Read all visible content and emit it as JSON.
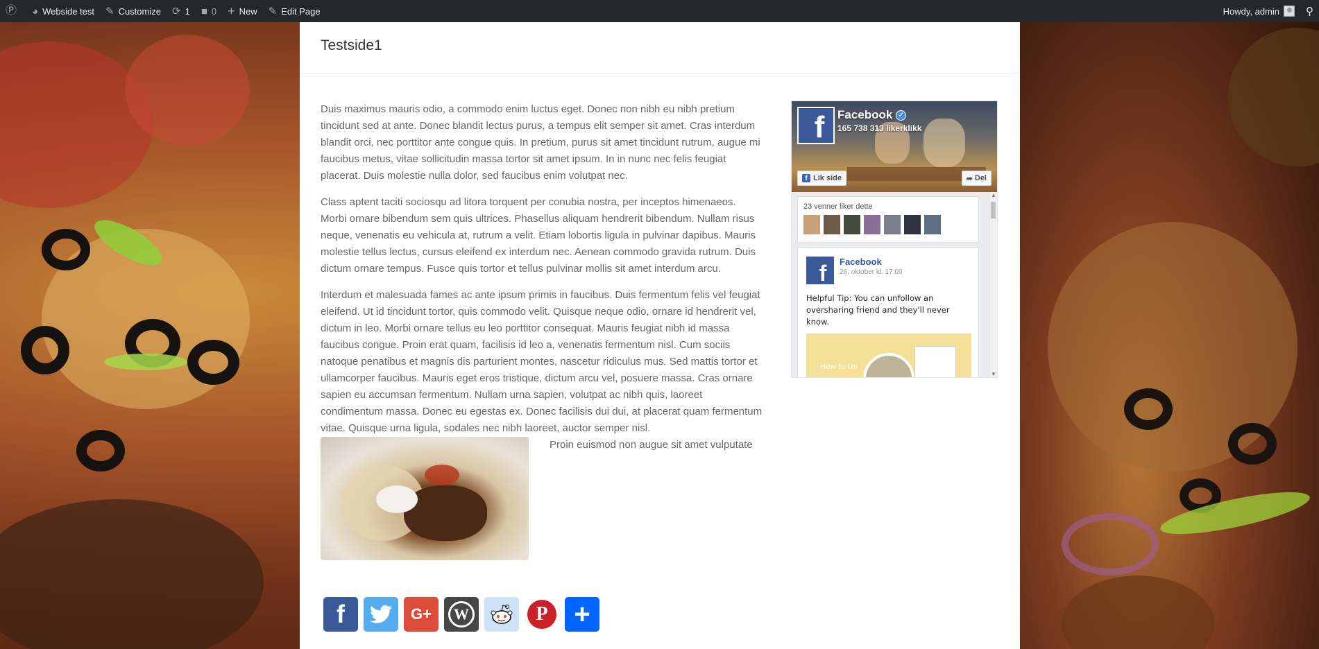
{
  "adminbar": {
    "site_name": "Webside test",
    "customize": "Customize",
    "updates_count": "1",
    "comments_count": "0",
    "new_label": "New",
    "edit_page": "Edit Page",
    "howdy": "Howdy, admin"
  },
  "page": {
    "title": "Testside1",
    "paragraphs": [
      "Duis maximus mauris odio, a commodo enim luctus eget. Donec non nibh eu nibh pretium tincidunt sed at ante. Donec blandit lectus purus, a tempus elit semper sit amet. Cras interdum blandit orci, nec porttitor ante congue quis. In pretium, purus sit amet tincidunt rutrum, augue mi faucibus metus, vitae sollicitudin massa tortor sit amet ipsum. In in nunc nec felis feugiat placerat. Duis molestie nulla dolor, sed faucibus enim volutpat nec.",
      "Class aptent taciti sociosqu ad litora torquent per conubia nostra, per inceptos himenaeos. Morbi ornare bibendum sem quis ultrices. Phasellus aliquam hendrerit bibendum. Nullam risus neque, venenatis eu vehicula at, rutrum a velit. Etiam lobortis ligula in pulvinar dapibus. Mauris molestie tellus lectus, cursus eleifend ex interdum nec. Aenean commodo gravida rutrum. Duis dictum ornare tempus. Fusce quis tortor et tellus pulvinar mollis sit amet interdum arcu.",
      "Interdum et malesuada fames ac ante ipsum primis in faucibus. Duis fermentum felis vel feugiat eleifend. Ut id tincidunt tortor, quis commodo velit. Quisque neque odio, ornare id hendrerit vel, dictum in leo. Morbi ornare tellus eu leo porttitor consequat. Mauris feugiat nibh id massa faucibus congue. Proin erat quam, facilisis id leo a, venenatis fermentum nisl. Cum sociis natoque penatibus et magnis dis parturient montes, nascetur ridiculus mus. Sed mattis tortor et ullamcorper faucibus. Mauris eget eros tristique, dictum arcu vel, posuere massa. Cras ornare sapien eu accumsan fermentum. Nullam urna sapien, volutpat ac nibh quis, laoreet condimentum massa. Donec eu egestas ex. Donec facilisis dui dui, at placerat quam fermentum vitae. Quisque urna ligula, sodales nec nibh laoreet, auctor semper nisl."
    ],
    "inline_text": "Proin euismod non augue sit amet vulputate"
  },
  "facebook": {
    "page_name": "Facebook",
    "likes": "165 738 313 likerklikk",
    "like_button": "Lik side",
    "share_button": "Del",
    "friends_text": "23 venner liker dette",
    "post_name": "Facebook",
    "post_date": "26. oktober kl. 17:00",
    "post_text": "Helpful Tip: You can unfollow an oversharing friend and they'll never know.",
    "video_caption": "How to Un"
  },
  "share": {
    "facebook_label": "f",
    "googleplus_label": "G+",
    "wordpress_label": "W",
    "pinterest_label": "P",
    "more_label": "+"
  },
  "colors": {
    "adminbar_bg": "#23282d",
    "facebook_blue": "#3b5998",
    "twitter_blue": "#55acee",
    "googleplus_red": "#dd4b39",
    "wordpress_gray": "#464646",
    "reddit_bg": "#cee3f8",
    "pinterest_red": "#cb2027",
    "addtoany_blue": "#0166ff"
  }
}
